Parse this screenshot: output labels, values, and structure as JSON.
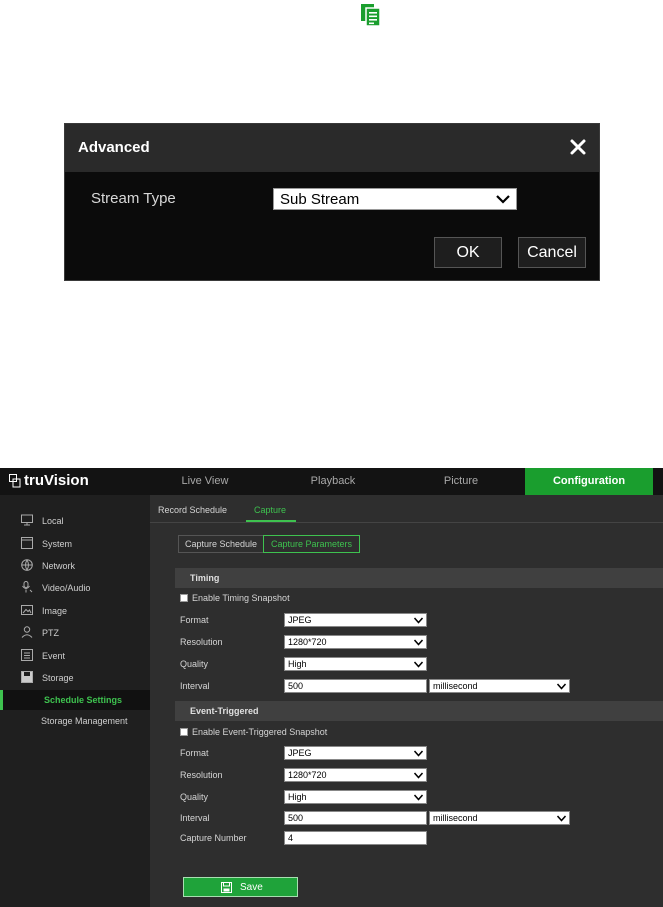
{
  "dialog": {
    "title": "Advanced",
    "stream_type_label": "Stream Type",
    "stream_type_value": "Sub Stream",
    "ok_label": "OK",
    "cancel_label": "Cancel"
  },
  "app": {
    "logo": "truVision",
    "nav": {
      "live_view": "Live View",
      "playback": "Playback",
      "picture": "Picture",
      "configuration": "Configuration"
    },
    "sidebar": {
      "items": [
        "Local",
        "System",
        "Network",
        "Video/Audio",
        "Image",
        "PTZ",
        "Event",
        "Storage"
      ],
      "sub_items": [
        "Schedule Settings",
        "Storage Management"
      ]
    },
    "tabs": {
      "record_schedule": "Record Schedule",
      "capture": "Capture"
    },
    "subtabs": {
      "capture_schedule": "Capture Schedule",
      "capture_parameters": "Capture Parameters"
    },
    "timing": {
      "title": "Timing",
      "enable_label": "Enable Timing Snapshot",
      "format_label": "Format",
      "format_value": "JPEG",
      "resolution_label": "Resolution",
      "resolution_value": "1280*720",
      "quality_label": "Quality",
      "quality_value": "High",
      "interval_label": "Interval",
      "interval_value": "500",
      "interval_unit": "millisecond"
    },
    "event": {
      "title": "Event-Triggered",
      "enable_label": "Enable Event-Triggered Snapshot",
      "format_label": "Format",
      "format_value": "JPEG",
      "resolution_label": "Resolution",
      "resolution_value": "1280*720",
      "quality_label": "Quality",
      "quality_value": "High",
      "interval_label": "Interval",
      "interval_value": "500",
      "interval_unit": "millisecond",
      "capture_number_label": "Capture Number",
      "capture_number_value": "4"
    },
    "save_label": "Save"
  },
  "colors": {
    "accent_green": "#1a9e2e",
    "dialog_bg": "#0b0b0b"
  }
}
